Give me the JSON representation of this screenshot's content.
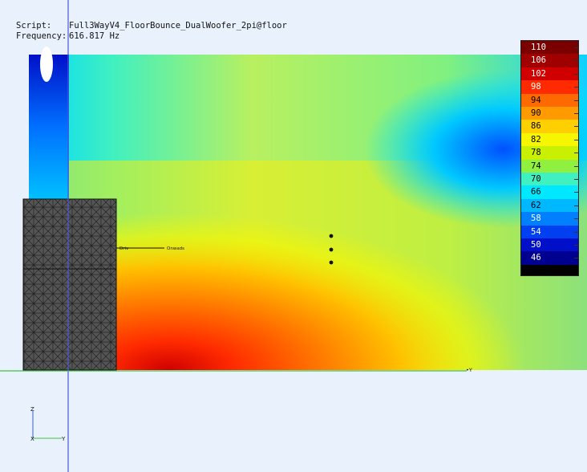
{
  "window": {
    "script_label": "Script:",
    "script_value": "Full3WayV4_FloorBounce_DualWoofer_2pi@floor",
    "frequency_label": "Frequency:",
    "frequency_value": "616.817 Hz"
  },
  "scene": {
    "driver_label_left": "Driv",
    "driver_label_right": "Onwads",
    "axis_marker_y": "•Y",
    "triad_z": "Z",
    "triad_x": "X",
    "triad_y": "Y"
  },
  "colorbar": {
    "labels": [
      "110",
      "106",
      "102",
      "98",
      "94",
      "90",
      "86",
      "82",
      "78",
      "74",
      "70",
      "66",
      "62",
      "58",
      "54",
      "50",
      "46"
    ],
    "colors": [
      "#7a0000",
      "#a00000",
      "#d00000",
      "#ff2a00",
      "#ff6a00",
      "#ff9a00",
      "#ffd000",
      "#f6f600",
      "#c8f000",
      "#90f040",
      "#40f0c0",
      "#00e8ff",
      "#00b8ff",
      "#0080ff",
      "#0040f0",
      "#0010c8",
      "#000090"
    ],
    "text_colors": [
      "#ffffff",
      "#ffffff",
      "#ffffff",
      "#ffffff",
      "#000000",
      "#000000",
      "#000000",
      "#000000",
      "#000000",
      "#000000",
      "#000000",
      "#000000",
      "#000000",
      "#ffffff",
      "#ffffff",
      "#ffffff",
      "#ffffff"
    ]
  },
  "icons": {
    "axis_triad": "axis-triad-icon",
    "measurement_points": "measurement-point-icon"
  }
}
